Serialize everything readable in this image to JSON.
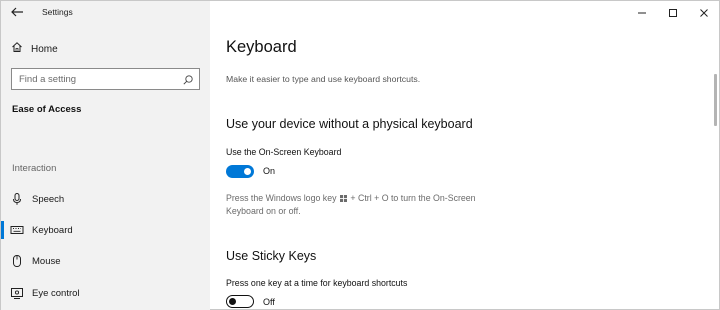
{
  "titlebar": {
    "back_icon": "back-arrow-icon",
    "app_title": "Settings",
    "controls": [
      "minimize-icon",
      "maximize-icon",
      "close-icon"
    ]
  },
  "sidebar": {
    "home": {
      "icon": "home-icon",
      "label": "Home"
    },
    "search": {
      "placeholder": "Find a setting",
      "value": "",
      "icon": "search-icon"
    },
    "section_title": "Ease of Access",
    "group_label": "Interaction",
    "items": [
      {
        "icon": "microphone-icon",
        "label": "Speech",
        "active": false
      },
      {
        "icon": "keyboard-icon",
        "label": "Keyboard",
        "active": true
      },
      {
        "icon": "mouse-icon",
        "label": "Mouse",
        "active": false
      },
      {
        "icon": "eye-control-icon",
        "label": "Eye control",
        "active": false
      }
    ]
  },
  "main": {
    "title": "Keyboard",
    "subtitle": "Make it easier to type and use keyboard shortcuts.",
    "sections": [
      {
        "heading": "Use your device without a physical keyboard",
        "setting_label": "Use the On-Screen Keyboard",
        "toggle_state": "On",
        "toggle_on": true,
        "desc_part1": "Press the Windows logo key",
        "desc_part2": "+ Ctrl + O to turn the On-Screen",
        "desc_line2": "Keyboard on or off."
      },
      {
        "heading": "Use Sticky Keys",
        "setting_label": "Press one key at a time for keyboard shortcuts",
        "toggle_state": "Off",
        "toggle_on": false
      }
    ]
  },
  "colors": {
    "accent": "#0078d7",
    "sidebar_bg": "#f2f2f2",
    "content_bg": "#ffffff",
    "secondary_text": "#6b6b6b"
  }
}
